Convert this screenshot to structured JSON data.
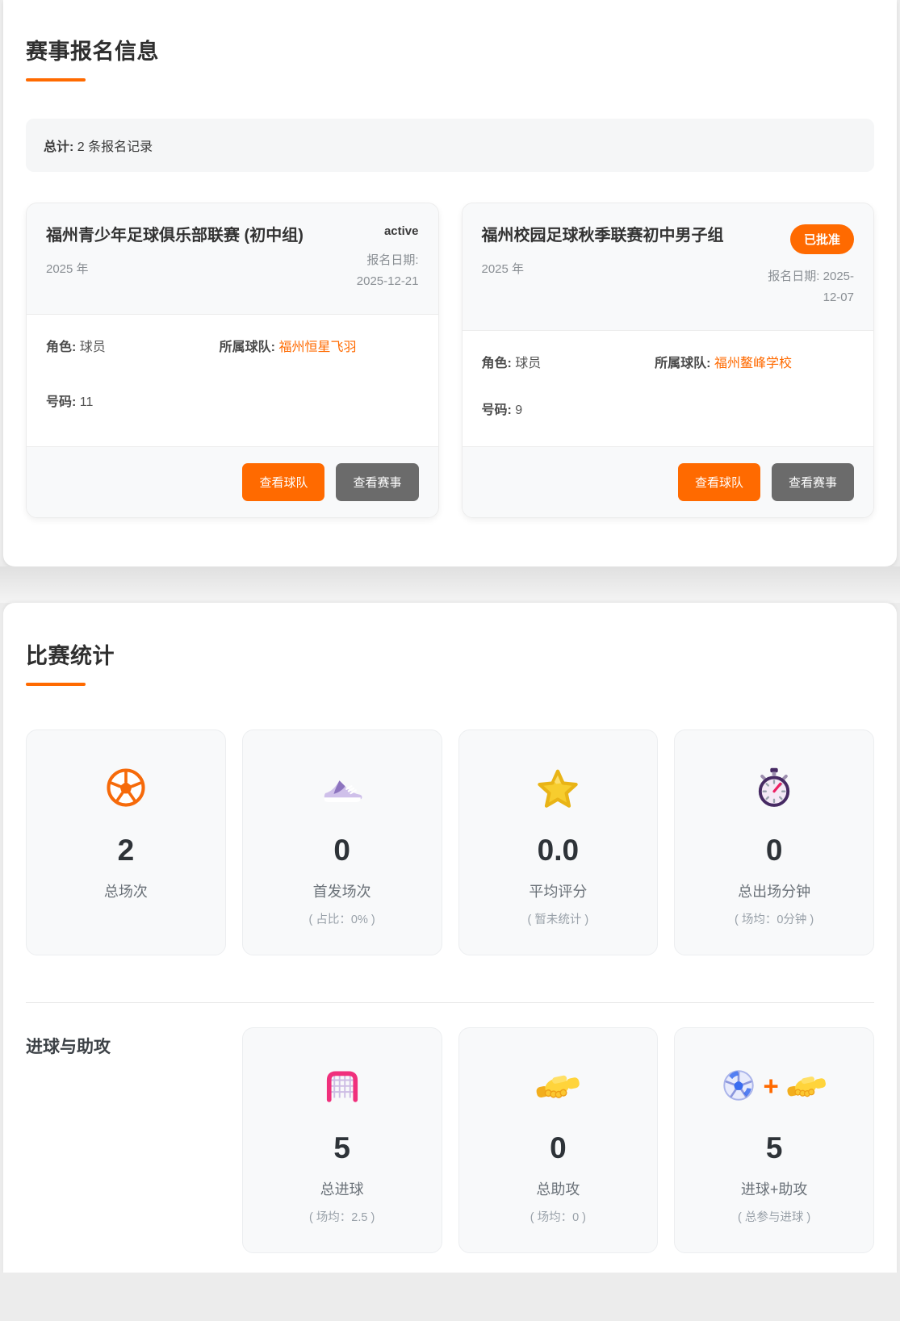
{
  "accent_color": "#ff6a00",
  "registration": {
    "title": "赛事报名信息",
    "summary_label": "总计:",
    "summary_text": " 2 条报名记录",
    "cards": [
      {
        "title": "福州青少年足球俱乐部联赛 (初中组)",
        "year": "2025 年",
        "status": "active",
        "date": "报名日期:\n2025-12-21",
        "role_label": "角色:",
        "role": "球员",
        "team_label": "所属球队:",
        "team": "福州恒星飞羽",
        "number_label": "号码:",
        "number": "11",
        "view_team_button": "查看球队",
        "view_event_button": "查看赛事"
      },
      {
        "title": "福州校园足球秋季联赛初中男子组",
        "year": "2025 年",
        "status": "已批准",
        "date": "报名日期: 2025-\n12-07",
        "role_label": "角色:",
        "role": "球员",
        "team_label": "所属球队:",
        "team": "福州鳌峰学校",
        "number_label": "号码:",
        "number": "9",
        "view_team_button": "查看球队",
        "view_event_button": "查看赛事"
      }
    ]
  },
  "stats_section": {
    "title": "比赛统计",
    "tiles": [
      {
        "icon": "soccer-ball-orange-icon",
        "value": "2",
        "label": "总场次",
        "caption": ""
      },
      {
        "icon": "running-shoe-icon",
        "value": "0",
        "label": "首发场次",
        "caption": "( 占比：0% )"
      },
      {
        "icon": "star-icon",
        "value": "0.0",
        "label": "平均评分",
        "caption": "( 暂未统计 )"
      },
      {
        "icon": "stopwatch-icon",
        "value": "0",
        "label": "总出场分钟",
        "caption": "( 场均：0分钟 )"
      }
    ],
    "goals_subsection": {
      "title": "进球与助攻",
      "plus_sign": "+",
      "tiles": [
        {
          "icon": "goal-net-icon",
          "value": "5",
          "label": "总进球",
          "caption": "( 场均：2.5 )"
        },
        {
          "icon": "handshake-icon",
          "value": "0",
          "label": "总助攻",
          "caption": "( 场均：0 )"
        },
        {
          "icon": "ball-plus-handshake-icon",
          "value": "5",
          "label": "进球+助攻",
          "caption": "( 总参与进球 )"
        }
      ]
    }
  }
}
